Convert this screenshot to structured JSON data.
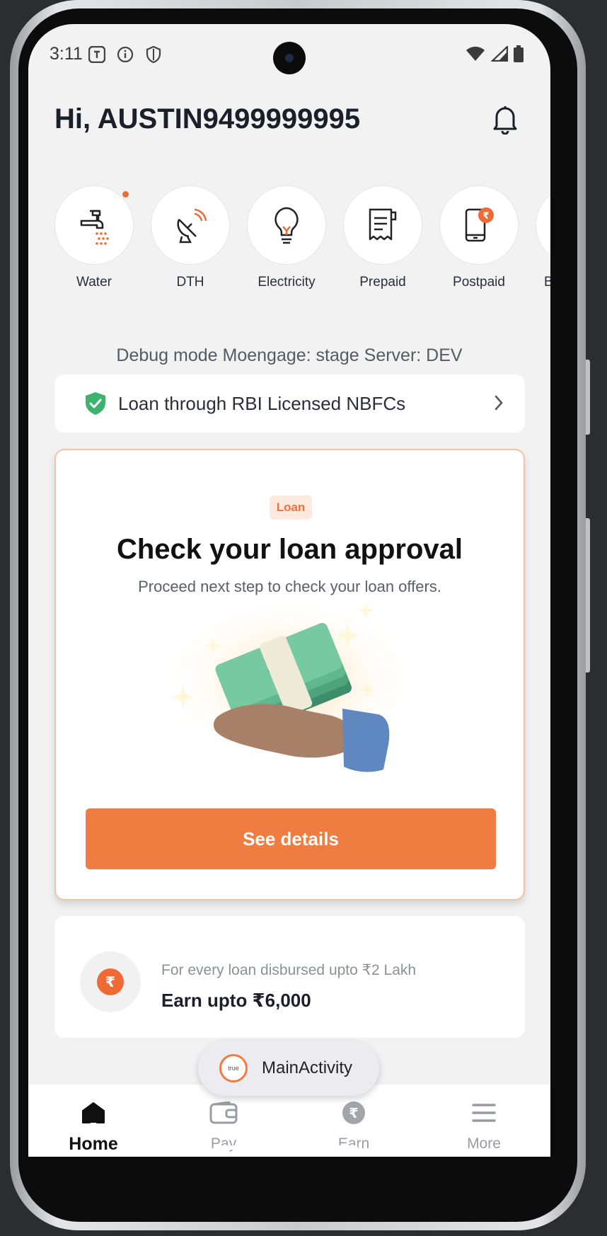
{
  "status_bar": {
    "time": "3:11"
  },
  "header": {
    "greeting": "Hi, AUSTIN9499999995"
  },
  "services": [
    {
      "label": "Water",
      "icon": "water-tap-icon"
    },
    {
      "label": "DTH",
      "icon": "satellite-dish-icon"
    },
    {
      "label": "Electricity",
      "icon": "bulb-icon"
    },
    {
      "label": "Prepaid",
      "icon": "receipt-icon"
    },
    {
      "label": "Postpaid",
      "icon": "phone-rupee-icon"
    },
    {
      "label": "B",
      "icon": "partial-icon"
    }
  ],
  "debug": {
    "text": "Debug mode Moengage: stage  Server: DEV"
  },
  "nbfc_banner": {
    "text": "Loan through RBI Licensed NBFCs"
  },
  "loan_card": {
    "tag": "Loan",
    "title": "Check your loan approval",
    "subtitle": "Proceed next step to check your loan offers.",
    "button": "See details"
  },
  "earn_card": {
    "subtitle": "For every loan disbursed upto ₹2 Lakh",
    "title": "Earn upto ₹6,000",
    "icon_symbol": "₹"
  },
  "toast": {
    "logo_text": "true",
    "message": "MainActivity"
  },
  "bottom_nav": [
    {
      "label": "Home",
      "active": true
    },
    {
      "label": "Pay",
      "active": false
    },
    {
      "label": "Earn",
      "active": false
    },
    {
      "label": "More",
      "active": false
    }
  ],
  "colors": {
    "accent": "#ef7d41",
    "background": "#f2f2f2",
    "shield_green": "#3bb36f"
  }
}
